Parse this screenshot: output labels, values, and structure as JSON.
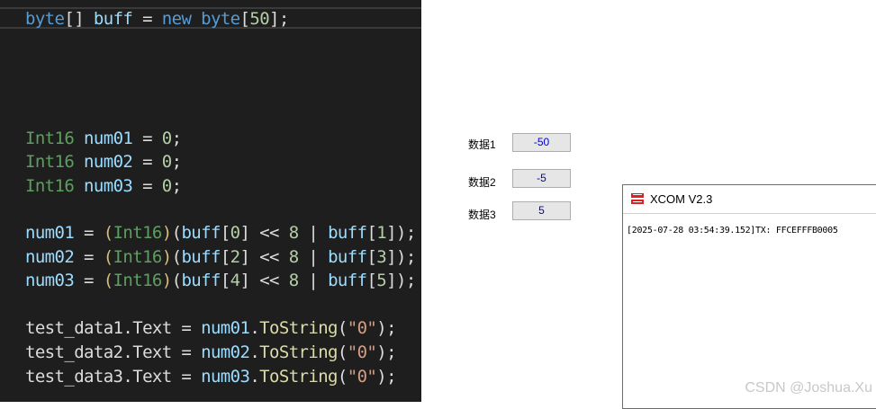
{
  "editor": {
    "lines": [
      [
        {
          "t": "byte",
          "c": "c-kw"
        },
        {
          "t": "[] ",
          "c": "c-plain"
        },
        {
          "t": "buff",
          "c": "c-var"
        },
        {
          "t": " = ",
          "c": "c-plain"
        },
        {
          "t": "new",
          "c": "c-kw"
        },
        {
          "t": " ",
          "c": "c-plain"
        },
        {
          "t": "byte",
          "c": "c-kw"
        },
        {
          "t": "[",
          "c": "c-plain"
        },
        {
          "t": "50",
          "c": "c-num"
        },
        {
          "t": "];",
          "c": "c-plain"
        }
      ],
      [
        {
          "t": "Int16",
          "c": "c-type2"
        },
        {
          "t": " ",
          "c": "c-plain"
        },
        {
          "t": "num01",
          "c": "c-var"
        },
        {
          "t": " = ",
          "c": "c-plain"
        },
        {
          "t": "0",
          "c": "c-num"
        },
        {
          "t": ";",
          "c": "c-plain"
        }
      ],
      [
        {
          "t": "Int16",
          "c": "c-type2"
        },
        {
          "t": " ",
          "c": "c-plain"
        },
        {
          "t": "num02",
          "c": "c-var"
        },
        {
          "t": " = ",
          "c": "c-plain"
        },
        {
          "t": "0",
          "c": "c-num"
        },
        {
          "t": ";",
          "c": "c-plain"
        }
      ],
      [
        {
          "t": "Int16",
          "c": "c-type2"
        },
        {
          "t": " ",
          "c": "c-plain"
        },
        {
          "t": "num03",
          "c": "c-var"
        },
        {
          "t": " = ",
          "c": "c-plain"
        },
        {
          "t": "0",
          "c": "c-num"
        },
        {
          "t": ";",
          "c": "c-plain"
        }
      ],
      [
        {
          "t": "num01",
          "c": "c-var"
        },
        {
          "t": " = ",
          "c": "c-plain"
        },
        {
          "t": "(",
          "c": "c-paren"
        },
        {
          "t": "Int16",
          "c": "c-type2"
        },
        {
          "t": ")",
          "c": "c-paren"
        },
        {
          "t": "(",
          "c": "c-plain"
        },
        {
          "t": "buff",
          "c": "c-var"
        },
        {
          "t": "[",
          "c": "c-plain"
        },
        {
          "t": "0",
          "c": "c-num"
        },
        {
          "t": "] << ",
          "c": "c-plain"
        },
        {
          "t": "8",
          "c": "c-num"
        },
        {
          "t": " | ",
          "c": "c-plain"
        },
        {
          "t": "buff",
          "c": "c-var"
        },
        {
          "t": "[",
          "c": "c-plain"
        },
        {
          "t": "1",
          "c": "c-num"
        },
        {
          "t": "]);",
          "c": "c-plain"
        }
      ],
      [
        {
          "t": "num02",
          "c": "c-var"
        },
        {
          "t": " = ",
          "c": "c-plain"
        },
        {
          "t": "(",
          "c": "c-paren"
        },
        {
          "t": "Int16",
          "c": "c-type2"
        },
        {
          "t": ")",
          "c": "c-paren"
        },
        {
          "t": "(",
          "c": "c-plain"
        },
        {
          "t": "buff",
          "c": "c-var"
        },
        {
          "t": "[",
          "c": "c-plain"
        },
        {
          "t": "2",
          "c": "c-num"
        },
        {
          "t": "] << ",
          "c": "c-plain"
        },
        {
          "t": "8",
          "c": "c-num"
        },
        {
          "t": " | ",
          "c": "c-plain"
        },
        {
          "t": "buff",
          "c": "c-var"
        },
        {
          "t": "[",
          "c": "c-plain"
        },
        {
          "t": "3",
          "c": "c-num"
        },
        {
          "t": "]);",
          "c": "c-plain"
        }
      ],
      [
        {
          "t": "num03",
          "c": "c-var"
        },
        {
          "t": " = ",
          "c": "c-plain"
        },
        {
          "t": "(",
          "c": "c-paren"
        },
        {
          "t": "Int16",
          "c": "c-type2"
        },
        {
          "t": ")",
          "c": "c-paren"
        },
        {
          "t": "(",
          "c": "c-plain"
        },
        {
          "t": "buff",
          "c": "c-var"
        },
        {
          "t": "[",
          "c": "c-plain"
        },
        {
          "t": "4",
          "c": "c-num"
        },
        {
          "t": "] << ",
          "c": "c-plain"
        },
        {
          "t": "8",
          "c": "c-num"
        },
        {
          "t": " | ",
          "c": "c-plain"
        },
        {
          "t": "buff",
          "c": "c-var"
        },
        {
          "t": "[",
          "c": "c-plain"
        },
        {
          "t": "5",
          "c": "c-num"
        },
        {
          "t": "]);",
          "c": "c-plain"
        }
      ],
      [
        {
          "t": "test_data1",
          "c": "c-plain"
        },
        {
          "t": ".",
          "c": "c-plain"
        },
        {
          "t": "Text",
          "c": "c-plain"
        },
        {
          "t": " = ",
          "c": "c-plain"
        },
        {
          "t": "num01",
          "c": "c-var"
        },
        {
          "t": ".",
          "c": "c-plain"
        },
        {
          "t": "ToString",
          "c": "c-fn"
        },
        {
          "t": "(",
          "c": "c-plain"
        },
        {
          "t": "\"0\"",
          "c": "c-str"
        },
        {
          "t": ");",
          "c": "c-plain"
        }
      ],
      [
        {
          "t": "test_data2",
          "c": "c-plain"
        },
        {
          "t": ".",
          "c": "c-plain"
        },
        {
          "t": "Text",
          "c": "c-plain"
        },
        {
          "t": " = ",
          "c": "c-plain"
        },
        {
          "t": "num02",
          "c": "c-var"
        },
        {
          "t": ".",
          "c": "c-plain"
        },
        {
          "t": "ToString",
          "c": "c-fn"
        },
        {
          "t": "(",
          "c": "c-plain"
        },
        {
          "t": "\"0\"",
          "c": "c-str"
        },
        {
          "t": ");",
          "c": "c-plain"
        }
      ],
      [
        {
          "t": "test_data3",
          "c": "c-plain"
        },
        {
          "t": ".",
          "c": "c-plain"
        },
        {
          "t": "Text",
          "c": "c-plain"
        },
        {
          "t": " = ",
          "c": "c-plain"
        },
        {
          "t": "num03",
          "c": "c-var"
        },
        {
          "t": ".",
          "c": "c-plain"
        },
        {
          "t": "ToString",
          "c": "c-fn"
        },
        {
          "t": "(",
          "c": "c-plain"
        },
        {
          "t": "\"0\"",
          "c": "c-str"
        },
        {
          "t": ");",
          "c": "c-plain"
        }
      ]
    ]
  },
  "form": {
    "fields": [
      {
        "label": "数据1",
        "value": "-50"
      },
      {
        "label": "数据2",
        "value": "-5"
      },
      {
        "label": "数据3",
        "value": "5"
      }
    ],
    "value_colors": [
      "#0000cc",
      "#0000cc",
      "#0000cc"
    ]
  },
  "xcom": {
    "logo_icon": "atk-logo-icon",
    "title": "XCOM V2.3",
    "log_line": "[2025-07-28 03:54:39.152]TX: FFCEFFFB0005"
  },
  "watermark": "CSDN @Joshua.Xu"
}
